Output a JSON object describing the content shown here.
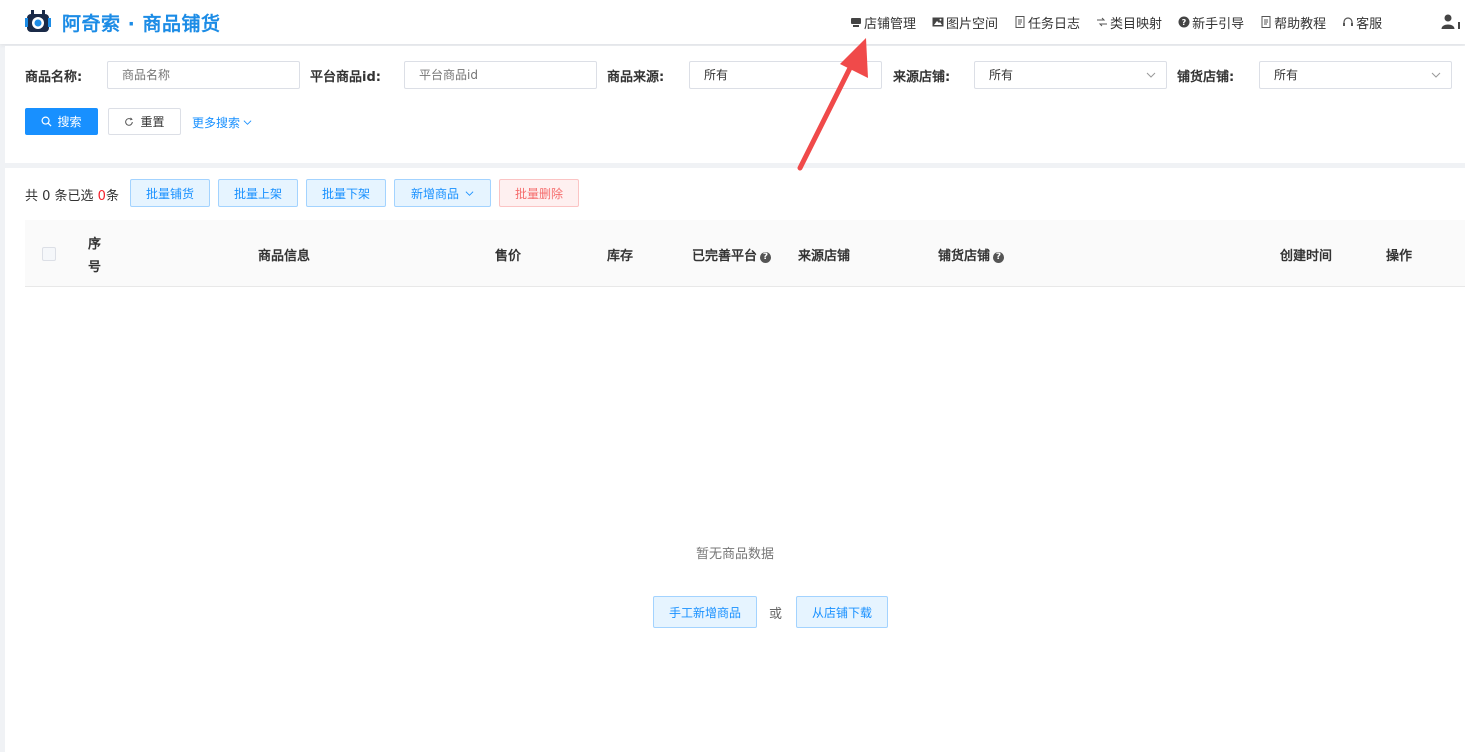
{
  "header": {
    "brand": "阿奇索 · 商品铺货",
    "nav": [
      {
        "icon": "store-icon",
        "label": "店铺管理"
      },
      {
        "icon": "image-icon",
        "label": "图片空间"
      },
      {
        "icon": "document-icon",
        "label": "任务日志"
      },
      {
        "icon": "mapping-icon",
        "label": "类目映射"
      },
      {
        "icon": "question-icon",
        "label": "新手引导"
      },
      {
        "icon": "document-icon",
        "label": "帮助教程"
      },
      {
        "icon": "headset-icon",
        "label": "客服"
      }
    ]
  },
  "filters": {
    "name_label": "商品名称:",
    "name_placeholder": "商品名称",
    "pid_label": "平台商品id:",
    "pid_placeholder": "平台商品id",
    "source_label": "商品来源:",
    "source_value": "所有",
    "src_shop_label": "来源店铺:",
    "src_shop_value": "所有",
    "dist_shop_label": "铺货店铺:",
    "dist_shop_value": "所有",
    "search_btn": "搜索",
    "reset_btn": "重置",
    "more_search": "更多搜索"
  },
  "toolbar": {
    "summary_prefix": "共 0 条已选 ",
    "selected_count": "0",
    "summary_suffix": "条",
    "batch_distribute": "批量铺货",
    "batch_on": "批量上架",
    "batch_off": "批量下架",
    "add_product": "新增商品",
    "batch_delete": "批量删除"
  },
  "table": {
    "columns": {
      "index_1": "序",
      "index_2": "号",
      "info": "商品信息",
      "price": "售价",
      "stock": "库存",
      "platforms": "已完善平台",
      "source_shop": "来源店铺",
      "dist_shop": "铺货店铺",
      "created": "创建时间",
      "actions": "操作"
    },
    "empty_text": "暂无商品数据",
    "manual_add": "手工新增商品",
    "or": "或",
    "download_from_shop": "从店铺下载"
  },
  "colors": {
    "brand": "#1c8ce6",
    "primary": "#1890ff",
    "danger": "#f5222d",
    "arrow": "#f04a4a"
  }
}
